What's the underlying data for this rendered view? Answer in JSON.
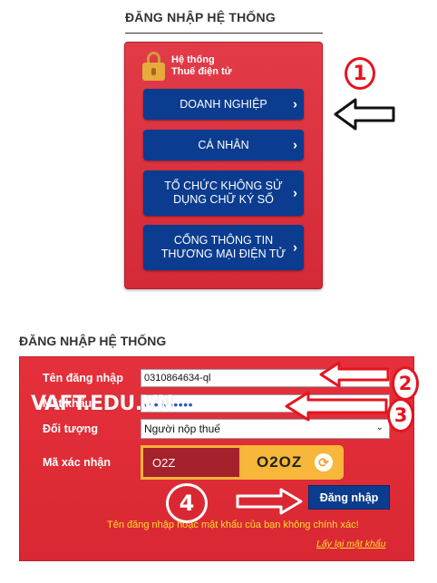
{
  "top_panel": {
    "title": "ĐĂNG NHẬP HỆ THỐNG",
    "system_label_line1": "Hệ thống",
    "system_label_line2": "Thuế điện tử",
    "buttons": [
      {
        "label": "DOANH NGHIỆP",
        "chevron": "›"
      },
      {
        "label": "CÁ NHÂN",
        "chevron": "›"
      },
      {
        "label": "TỔ CHỨC KHÔNG SỬ DỤNG CHỮ KÝ SỐ",
        "chevron": "›"
      },
      {
        "label": "CỔNG THÔNG TIN THƯƠNG MẠI ĐIỆN TỬ",
        "chevron": "›"
      }
    ],
    "annotation_number": "1"
  },
  "bottom_panel": {
    "title": "ĐĂNG NHẬP HỆ THỐNG",
    "username_label": "Tên đăng nhập",
    "username_value": "0310864634-ql",
    "password_label": "Mật khẩu",
    "password_value": "••••••••••",
    "object_label": "Đối tượng",
    "object_selected": "Người nộp thuế",
    "captcha_label": "Mã xác nhận",
    "captcha_input_value": "O2Z",
    "captcha_image_text": "O2OZ",
    "login_button": "Đăng nhập",
    "error_message": "Tên đăng nhập hoặc mật khẩu của bạn không chính xác!",
    "forgot_link": "Lấy lại mật khẩu",
    "annotation_numbers": [
      "2",
      "3",
      "4"
    ]
  },
  "watermark": "VAFT.EDU.VN",
  "colors": {
    "panel_red": "#d42a38",
    "button_blue": "#0b3c8f",
    "captcha_orange": "#f6b73a",
    "warning_yellow": "#ffde2a",
    "annotation_red": "#e4141f"
  },
  "icons": [
    "lock-icon",
    "chevron-right-icon",
    "refresh-icon",
    "arrow-left-icon",
    "arrow-right-icon"
  ]
}
